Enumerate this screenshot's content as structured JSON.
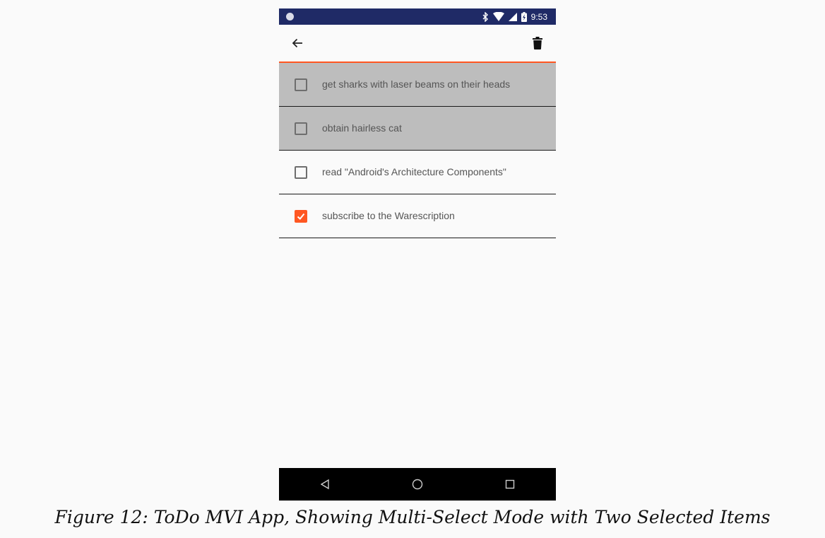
{
  "status_bar": {
    "time": "9:53",
    "icons": [
      "bluetooth-icon",
      "wifi-icon",
      "signal-icon",
      "battery-charging-icon"
    ],
    "background_color": "#1f2a66"
  },
  "toolbar": {
    "back_icon": "arrow-back-icon",
    "delete_icon": "trash-icon",
    "accent_color": "#ff5722"
  },
  "items": [
    {
      "label": "get sharks with laser beams on their heads",
      "completed": false,
      "selected": true
    },
    {
      "label": "obtain hairless cat",
      "completed": false,
      "selected": true
    },
    {
      "label": "read \"Android's Architecture Components\"",
      "completed": false,
      "selected": false
    },
    {
      "label": "subscribe to the Warescription",
      "completed": true,
      "selected": false
    }
  ],
  "nav_bar": {
    "buttons": [
      "back-triangle-icon",
      "home-circle-icon",
      "recents-square-icon"
    ]
  },
  "caption": "Figure 12: ToDo MVI App, Showing Multi-Select Mode with Two Selected Items"
}
